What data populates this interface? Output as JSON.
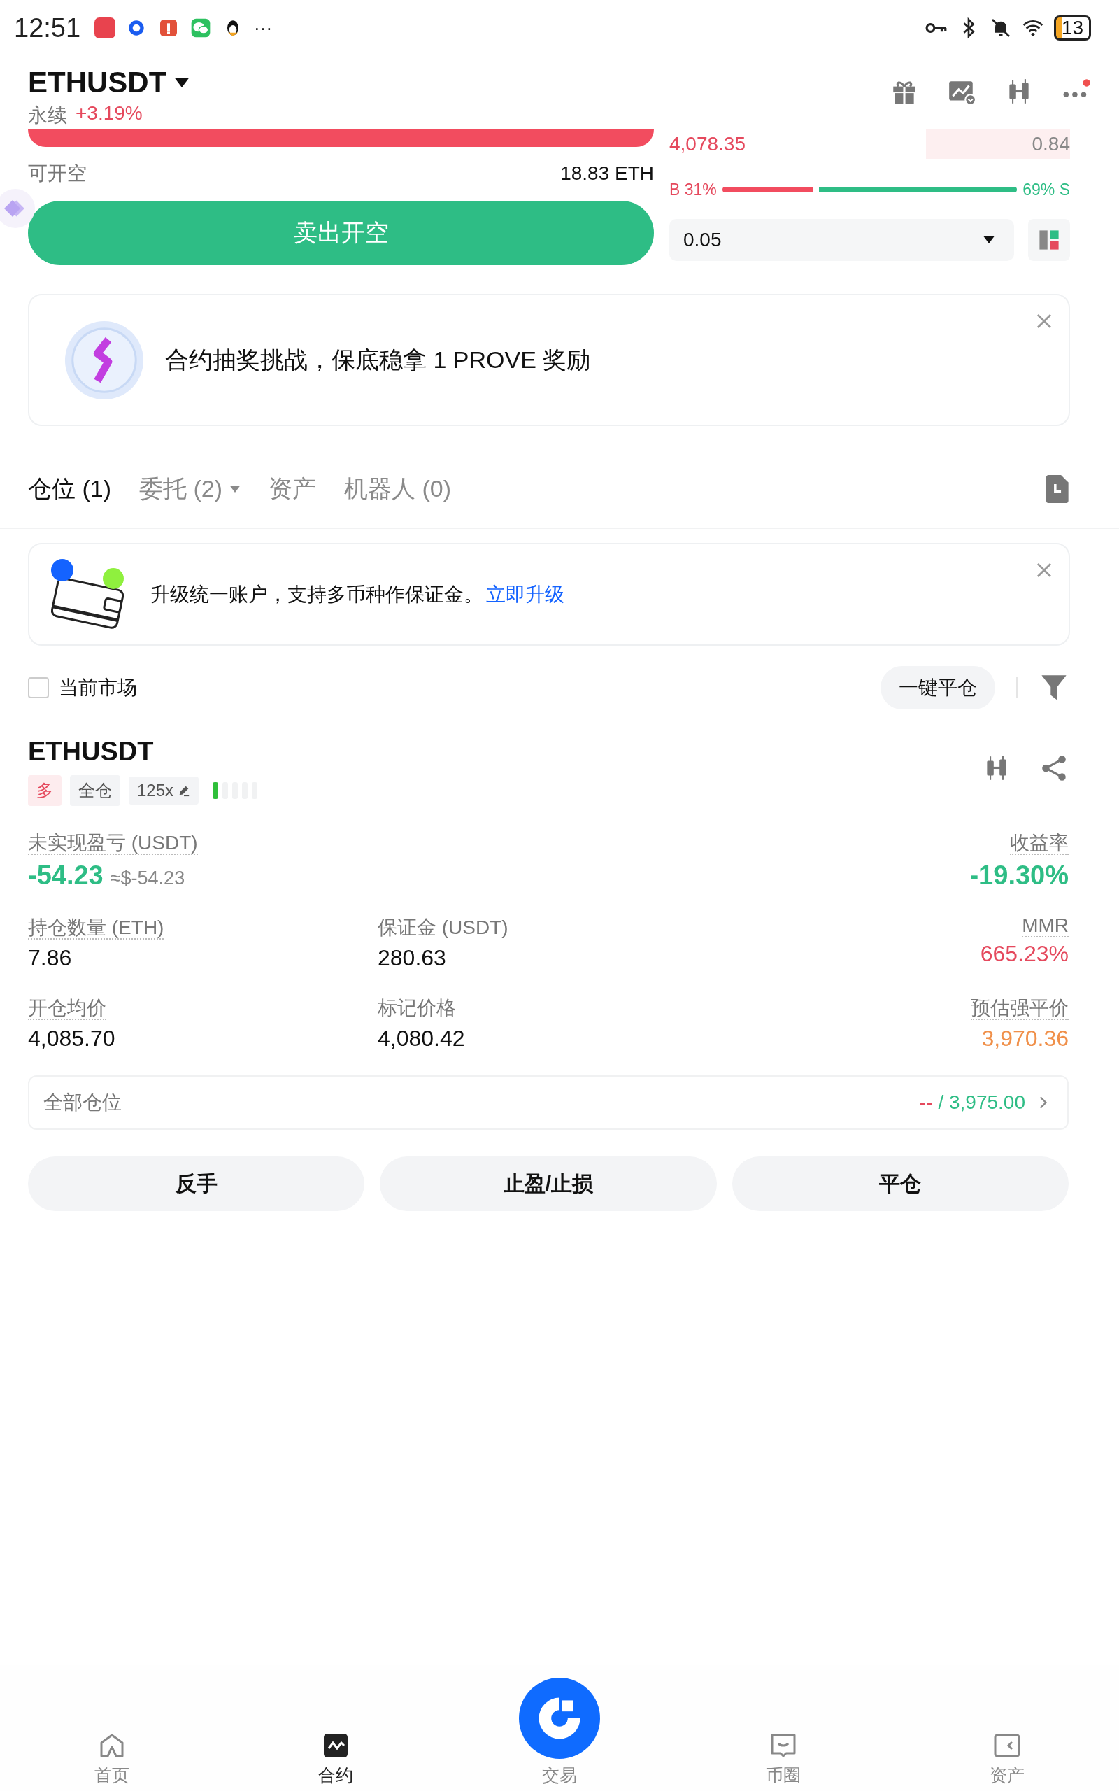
{
  "status_bar": {
    "time": "12:51",
    "more": "···",
    "battery": "13"
  },
  "header": {
    "symbol": "ETHUSDT",
    "type": "永续",
    "change": "+3.19%"
  },
  "order": {
    "available_label": "可开空",
    "available_value": "18.83 ETH",
    "submit": "卖出开空",
    "book_row": {
      "price": "4,078.35",
      "qty": "0.84"
    },
    "ratio": {
      "buy": "B 31%",
      "sell": "69% S"
    },
    "quantity": "0.05"
  },
  "promo": {
    "text": "合约抽奖挑战，保底稳拿 1 PROVE 奖励"
  },
  "tabs": [
    {
      "label": "仓位 (1)",
      "selected": true,
      "dropdown": false
    },
    {
      "label": "委托 (2)",
      "selected": false,
      "dropdown": true
    },
    {
      "label": "资产",
      "selected": false,
      "dropdown": false
    },
    {
      "label": "机器人 (0)",
      "selected": false,
      "dropdown": false
    }
  ],
  "notice": {
    "text": "升级统一账户，支持多币种作保证金。",
    "link": "立即升级"
  },
  "filter": {
    "label": "当前市场",
    "checked": false,
    "close_all": "一键平仓"
  },
  "position": {
    "symbol": "ETHUSDT",
    "tags": [
      {
        "label": "多",
        "kind": "side"
      },
      {
        "label": "全仓",
        "kind": "margin"
      },
      {
        "label": "125x",
        "kind": "leverage"
      }
    ],
    "risk": {
      "level": 0.2
    },
    "rows": [
      [
        {
          "label": "未实现盈亏 (USDT)",
          "value": "-54.23",
          "note": "≈$-54.23",
          "color": "#2ebd85",
          "hint": true,
          "big": true
        },
        "",
        {
          "label": "收益率",
          "value": "-19.30%",
          "color": "#2ebd85",
          "hint": true,
          "big": true
        }
      ],
      [
        {
          "label": "持仓数量 (ETH)",
          "value": "7.86",
          "color": "#111111",
          "hint": true,
          "big": false
        },
        {
          "label": "保证金 (USDT)",
          "value": "280.63",
          "color": "#111111",
          "hint": false,
          "big": false
        },
        {
          "label": "MMR",
          "value": "665.23%",
          "color": "#e5495d",
          "hint": true,
          "big": false
        }
      ],
      [
        {
          "label": "开仓均价",
          "value": "4,085.70",
          "color": "#111111",
          "hint": true,
          "big": false
        },
        {
          "label": "标记价格",
          "value": "4,080.42",
          "color": "#111111",
          "hint": false,
          "big": false
        },
        {
          "label": "预估强平价",
          "value": "3,970.36",
          "color": "#f0904a",
          "hint": true,
          "big": false
        }
      ]
    ],
    "all": {
      "label": "全部仓位",
      "tp": "--",
      "sl": "/ 3,975.00"
    },
    "actions": [
      "反手",
      "止盈/止损",
      "平仓"
    ]
  },
  "nav": [
    {
      "label": "首页",
      "kind": "home",
      "selected": false
    },
    {
      "label": "合约",
      "kind": "contract",
      "selected": true
    },
    {
      "label": "交易",
      "kind": "trade",
      "selected": false
    },
    {
      "label": "币圈",
      "kind": "community",
      "selected": false
    },
    {
      "label": "资产",
      "kind": "wallet",
      "selected": false
    }
  ]
}
